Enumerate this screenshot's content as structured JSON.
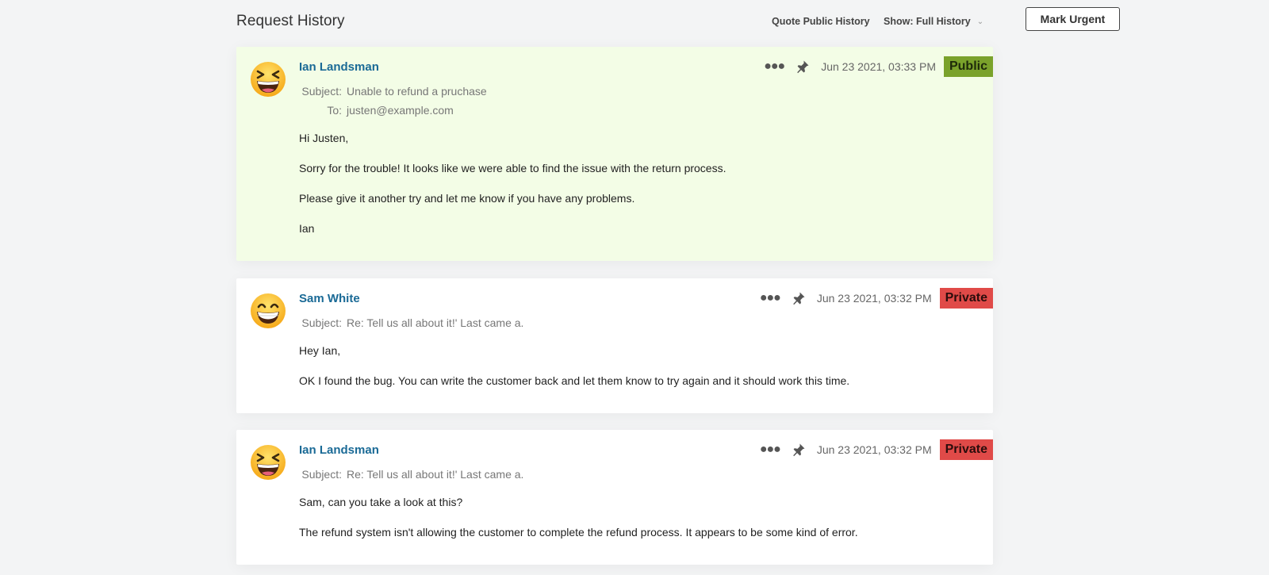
{
  "header": {
    "title": "Request History",
    "quote_public": "Quote Public History",
    "show_filter": "Show: Full History",
    "mark_urgent": "Mark Urgent"
  },
  "messages": [
    {
      "author": "Ian Landsman",
      "avatar": "squinting-face-icon",
      "date": "Jun 23 2021, 03:33 PM",
      "badge": "Public",
      "subject_label": "Subject:",
      "subject": "Unable to refund a pruchase",
      "to_label": "To:",
      "to": "justen@example.com",
      "body": [
        "Hi Justen,",
        "Sorry for the trouble! It looks like we were able to find the issue with the return process.",
        "Please give it another try and let me know if you have any problems.",
        "Ian"
      ]
    },
    {
      "author": "Sam White",
      "avatar": "grinning-face-icon",
      "date": "Jun 23 2021, 03:32 PM",
      "badge": "Private",
      "subject_label": "Subject:",
      "subject": "Re: Tell us all about it!' Last came a.",
      "body": [
        "Hey Ian,",
        "OK I found the bug. You can write the customer back and let them know to try again and it should work this time."
      ]
    },
    {
      "author": "Ian Landsman",
      "avatar": "squinting-face-icon",
      "date": "Jun 23 2021, 03:32 PM",
      "badge": "Private",
      "subject_label": "Subject:",
      "subject": "Re: Tell us all about it!' Last came a.",
      "body": [
        "Sam, can you take a look at this?",
        "The refund system isn't allowing the customer to complete the refund process. It appears to be some kind of error."
      ]
    }
  ],
  "colors": {
    "public_bg": "#f3fde6",
    "public_badge": "#7aa22b",
    "private_badge": "#e04a48",
    "author_link": "#1a6a96"
  }
}
